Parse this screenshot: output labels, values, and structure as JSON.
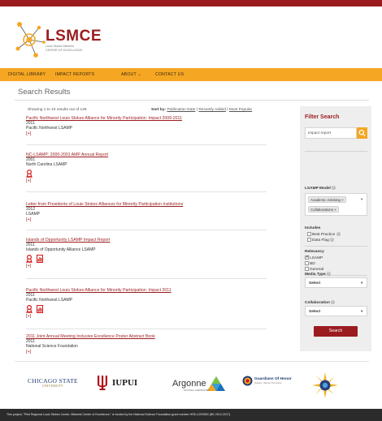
{
  "brand": {
    "logo_title": "LSMCE",
    "logo_line1": "Louis Stokes Midwest",
    "logo_line2": "CENTER OF EXCELLENCE"
  },
  "nav": {
    "items": [
      "DIGITAL LIBRARY",
      "IMPACT REPORTS",
      "ABOUT",
      "CONTACT US"
    ],
    "about_caret": "⌄"
  },
  "page": {
    "title": "Search Results",
    "showing": "Showing 1 to 10 results out of 126",
    "sort_label": "Sort by:",
    "sort_options": [
      "Publication Date",
      "Recently Added",
      "Most Popular"
    ],
    "sort_sep": " | "
  },
  "results": [
    {
      "title": "Pacific Northwest Louis Stokes Alliance for Minority Participation: Impact 2009-2011",
      "year": "2011",
      "org": "Pacific Northwest LSAMP",
      "more": "[+]"
    },
    {
      "title": "NC-LSAMP: 2000-2001 AMP Annual Report",
      "year": "2001",
      "org": "North Carolina LSAMP",
      "more": "[+]"
    },
    {
      "title": "Letter from Presidents of Louis Stokes Alliances for Minority Participation Institutions",
      "year": "2012",
      "org": "LSAMP",
      "more": "[+]"
    },
    {
      "title": "Islands of Opportunity LSAMP Impact Report",
      "year": "2011",
      "org": "Islands of Opportunity Alliance LSAMP",
      "more": "[+]"
    },
    {
      "title": "Pacific Northwest Louis Stokes Alliance for Minority Participation: Impact 2011",
      "year": "2011",
      "org": "Pacific Northwest LSAMP",
      "more": "[+]"
    },
    {
      "title": "2011 Joint Annual Meeting Inclusive Excellence Poster Abstract Book",
      "year": "2011",
      "org": "National Science Foundation",
      "more": "[+]"
    }
  ],
  "sidebar": {
    "heading": "Filter Search",
    "search_value": "impact report",
    "lsamp_model_label": "LSAMP Model",
    "lsamp_chips": [
      "Academic Advising ×",
      "Collaborations ×"
    ],
    "includes_label": "Includes",
    "includes": [
      "Best Practice",
      "Data Flag"
    ],
    "relevancy_label": "Relevancy",
    "relevancy": [
      "LSAMP",
      "BD",
      "General"
    ],
    "media_label": "Media Type",
    "media_value": "Select",
    "collab_label": "Collaboration",
    "collab_value": "Select",
    "search_button": "Search",
    "info_glyph": "i"
  },
  "partners": {
    "chicago_1": "CHICAGO STATE",
    "chicago_2": "UNIVERSITY",
    "iupui": "IUPUI",
    "argonne": "Argonne",
    "argonne_sub": "NATIONAL LABORATORY",
    "guardians": "Guardians Of Honor",
    "guardians_sub": "Integrity • We Are The Future"
  },
  "footer": {
    "text": "This project, \"Pilot Regional Louis Stokes Center: Midwest Center of Excellence,\" is funded by the National Science Foundation grant number HRD-1202563 (BD 2012-2017)."
  },
  "colors": {
    "crimson": "#9b1c1f",
    "orange": "#f5a623",
    "footer_bg": "#2b2b2b"
  }
}
